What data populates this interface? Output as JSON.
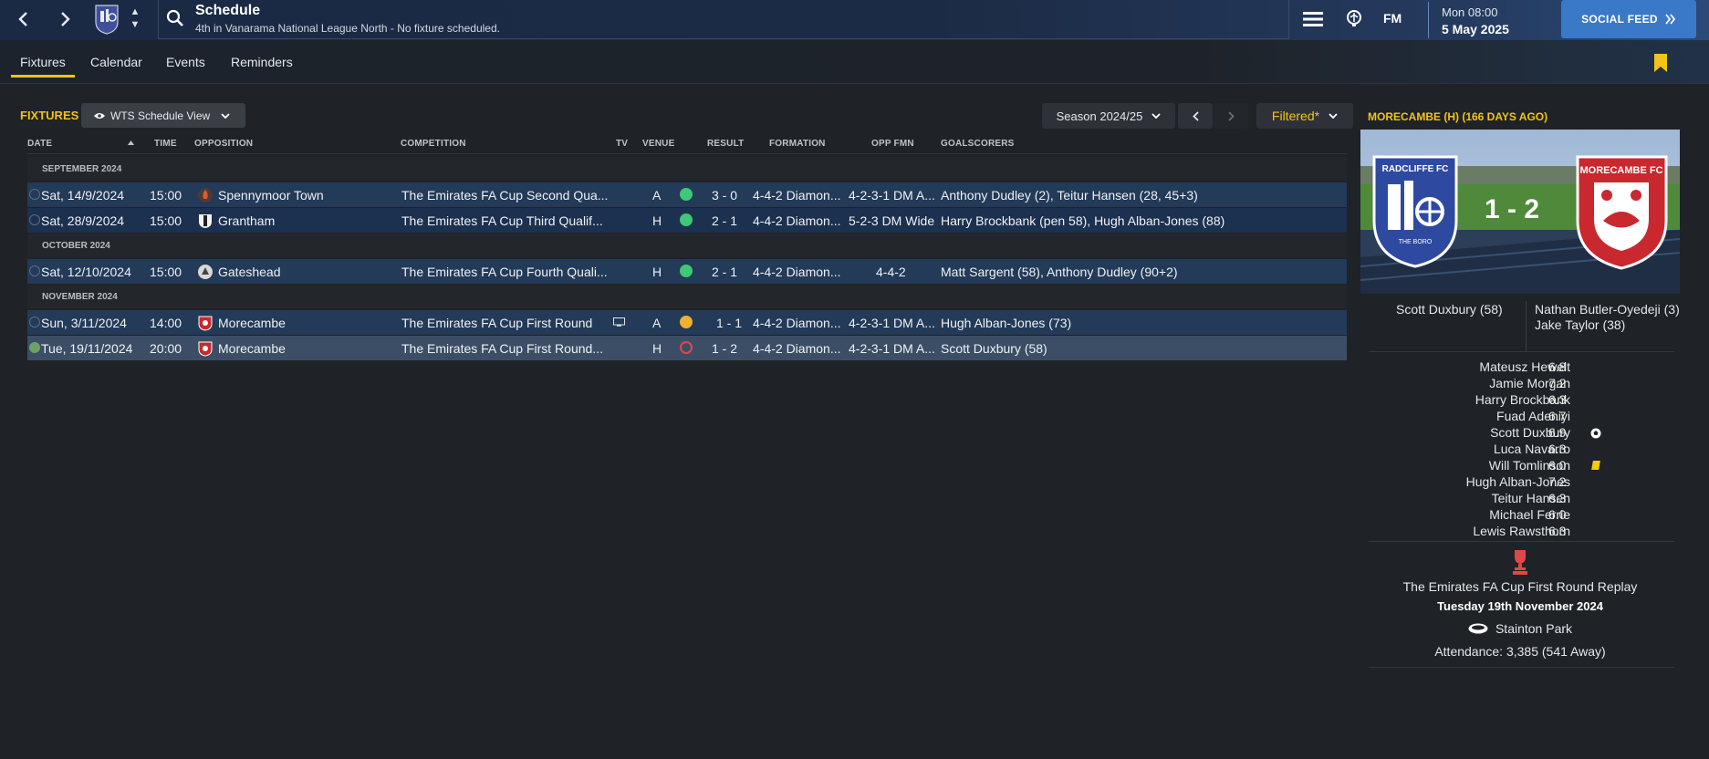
{
  "header": {
    "title": "Schedule",
    "subtitle": "4th in Vanarama National League North - No fixture scheduled.",
    "fm_logo": "FM",
    "date_day": "Mon 08:00",
    "date_full": "5 May 2025",
    "social_feed": "SOCIAL FEED"
  },
  "tabs": [
    {
      "label": "Fixtures"
    },
    {
      "label": "Calendar"
    },
    {
      "label": "Events"
    },
    {
      "label": "Reminders"
    }
  ],
  "toolbar": {
    "fixtures_label": "FIXTURES",
    "view_label": "WTS Schedule View",
    "season_label": "Season 2024/25",
    "filtered_label": "Filtered*"
  },
  "columns": {
    "date": "DATE",
    "time": "TIME",
    "opposition": "OPPOSITION",
    "competition": "COMPETITION",
    "tv": "TV",
    "venue": "VENUE",
    "result": "RESULT",
    "formation": "FORMATION",
    "opp_fmn": "OPP FMN",
    "goalscorers": "GOALSCORERS"
  },
  "months": [
    "SEPTEMBER 2024",
    "OCTOBER 2024",
    "NOVEMBER 2024"
  ],
  "fixtures": [
    {
      "date": "Sat, 14/9/2024",
      "time": "15:00",
      "opposition": "Spennymoor Town",
      "competition": "The Emirates FA Cup Second Qua...",
      "venue": "A",
      "outcome": "win",
      "result": "3 - 0",
      "formation": "4-4-2 Diamon...",
      "opp_fmn": "4-2-3-1 DM A...",
      "goalscorers": "Anthony Dudley (2), Teitur Hansen (28, 45+3)"
    },
    {
      "date": "Sat, 28/9/2024",
      "time": "15:00",
      "opposition": "Grantham",
      "competition": "The Emirates FA Cup Third Qualif...",
      "venue": "H",
      "outcome": "win",
      "result": "2 - 1",
      "formation": "4-4-2 Diamon...",
      "opp_fmn": "5-2-3 DM Wide",
      "goalscorers": "Harry Brockbank (pen 58), Hugh Alban-Jones (88)"
    },
    {
      "date": "Sat, 12/10/2024",
      "time": "15:00",
      "opposition": "Gateshead",
      "competition": "The Emirates FA Cup Fourth Quali...",
      "venue": "H",
      "outcome": "win",
      "result": "2 - 1",
      "formation": "4-4-2 Diamon...",
      "opp_fmn": "4-4-2",
      "goalscorers": "Matt Sargent (58), Anthony Dudley (90+2)"
    },
    {
      "date": "Sun, 3/11/2024",
      "time": "14:00",
      "opposition": "Morecambe",
      "competition": "The Emirates FA Cup First Round",
      "venue": "A",
      "outcome": "draw",
      "result": "1 - 1",
      "formation": "4-4-2 Diamon...",
      "opp_fmn": "4-2-3-1 DM A...",
      "goalscorers": "Hugh Alban-Jones (73)"
    },
    {
      "date": "Tue, 19/11/2024",
      "time": "20:00",
      "opposition": "Morecambe",
      "competition": "The Emirates FA Cup First Round...",
      "venue": "H",
      "outcome": "loss",
      "result": "1 - 2",
      "formation": "4-4-2 Diamon...",
      "opp_fmn": "4-2-3-1 DM A...",
      "goalscorers": "Scott Duxbury (58)"
    }
  ],
  "match_panel": {
    "title": "MORECAMBE (H) (166 DAYS AGO)",
    "home_badge": "RADCLIFFE FC",
    "home_motto": "THE BORO",
    "away_badge": "MORECAMBE FC",
    "score": "1 - 2",
    "home_scorers": "Scott Duxbury (58)",
    "away_scorer_1": "Nathan Butler-Oyedeji (3)",
    "away_scorer_2": "Jake Taylor (38)",
    "players": [
      {
        "name": "Mateusz Hewelt",
        "rating": "6.8"
      },
      {
        "name": "Jamie Morgan",
        "rating": "7.2"
      },
      {
        "name": "Harry Brockbank",
        "rating": "6.3"
      },
      {
        "name": "Fuad Adeniyi",
        "rating": "6.7"
      },
      {
        "name": "Scott Duxbury",
        "rating": "6.9"
      },
      {
        "name": "Luca Navarro",
        "rating": "6.3"
      },
      {
        "name": "Will Tomlinson",
        "rating": "6.0"
      },
      {
        "name": "Hugh Alban-Jones",
        "rating": "7.2"
      },
      {
        "name": "Teitur Hansen",
        "rating": "6.3"
      },
      {
        "name": "Michael Ferrie",
        "rating": "6.0"
      },
      {
        "name": "Lewis Rawsthorn",
        "rating": "6.3"
      }
    ],
    "competition": "The Emirates FA Cup First Round Replay",
    "match_date": "Tuesday 19th November 2024",
    "stadium": "Stainton Park",
    "attendance": "Attendance: 3,385 (541 Away)"
  },
  "colors": {
    "accent": "#f0c419",
    "win": "#3ec878",
    "draw": "#f0b030",
    "loss": "#e04848",
    "social_button": "#3a79c8"
  }
}
